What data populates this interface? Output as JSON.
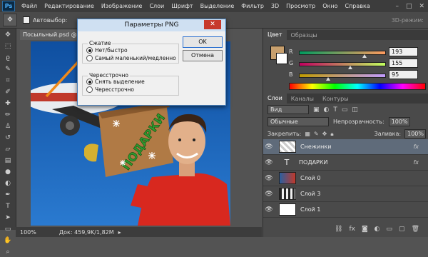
{
  "app": {
    "logo": "Ps"
  },
  "menu": [
    "Файл",
    "Редактирование",
    "Изображение",
    "Слои",
    "Шрифт",
    "Выделение",
    "Фильтр",
    "3D",
    "Просмотр",
    "Окно",
    "Справка"
  ],
  "options": {
    "autoselect_label": "Автовыбор:",
    "mode_label": "3D-режим:"
  },
  "document": {
    "tab_title": "Посыльный.psd @",
    "zoom": "100%",
    "doc_info": "Док: 459,9K/1,82M"
  },
  "canvas": {
    "box_text": "ПОДАРКИ"
  },
  "dialog": {
    "title": "Параметры PNG",
    "compression_label": "Сжатие",
    "compression_options": [
      "Нет/быстро",
      "Самый маленький/медленно"
    ],
    "interlace_label": "Чересстрочно",
    "interlace_options": [
      "Снять выделение",
      "Чересстрочно"
    ],
    "ok_label": "OK",
    "cancel_label": "Отмена"
  },
  "color_panel": {
    "tabs": [
      "Цвет",
      "Образцы"
    ],
    "fg_color": "#c8a06e",
    "rows": [
      {
        "label": "R",
        "value": "193"
      },
      {
        "label": "G",
        "value": "155"
      },
      {
        "label": "B",
        "value": "95"
      }
    ]
  },
  "layers_panel": {
    "tabs": [
      "Слои",
      "Каналы",
      "Контуры"
    ],
    "filter_label": "Вид",
    "blend_mode": "Обычные",
    "opacity_label": "Непрозрачность:",
    "opacity_value": "100%",
    "lock_label": "Закрепить:",
    "fill_label": "Заливка:",
    "fill_value": "100%",
    "layers": [
      {
        "name": "Снежинки",
        "fx": "fx"
      },
      {
        "name": "ПОДАРКИ",
        "fx": "fx"
      },
      {
        "name": "Слой 0",
        "fx": ""
      },
      {
        "name": "Слой 3",
        "fx": ""
      },
      {
        "name": "Слой 1",
        "fx": ""
      }
    ]
  }
}
